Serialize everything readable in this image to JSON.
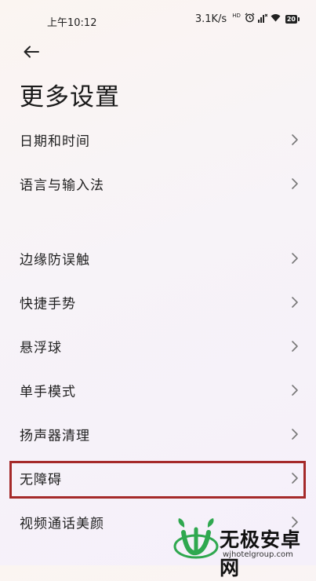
{
  "status_bar": {
    "time": "上午10:12",
    "network_speed": "3.1K/s",
    "hd_label": "HD",
    "battery": "20"
  },
  "header": {
    "title": "更多设置"
  },
  "settings_group_1": [
    {
      "label": "日期和时间"
    },
    {
      "label": "语言与输入法"
    }
  ],
  "settings_group_2": [
    {
      "label": "边缘防误触"
    },
    {
      "label": "快捷手势"
    },
    {
      "label": "悬浮球"
    },
    {
      "label": "单手模式"
    },
    {
      "label": "扬声器清理"
    },
    {
      "label": "无障碍",
      "highlighted": true
    },
    {
      "label": "视频通话美颜"
    }
  ],
  "watermark": {
    "title": "无极安卓网",
    "url": "wjhotelgroup.com"
  },
  "colors": {
    "highlight_border": "#a52a2a",
    "watermark_green": "#2fa84f"
  }
}
